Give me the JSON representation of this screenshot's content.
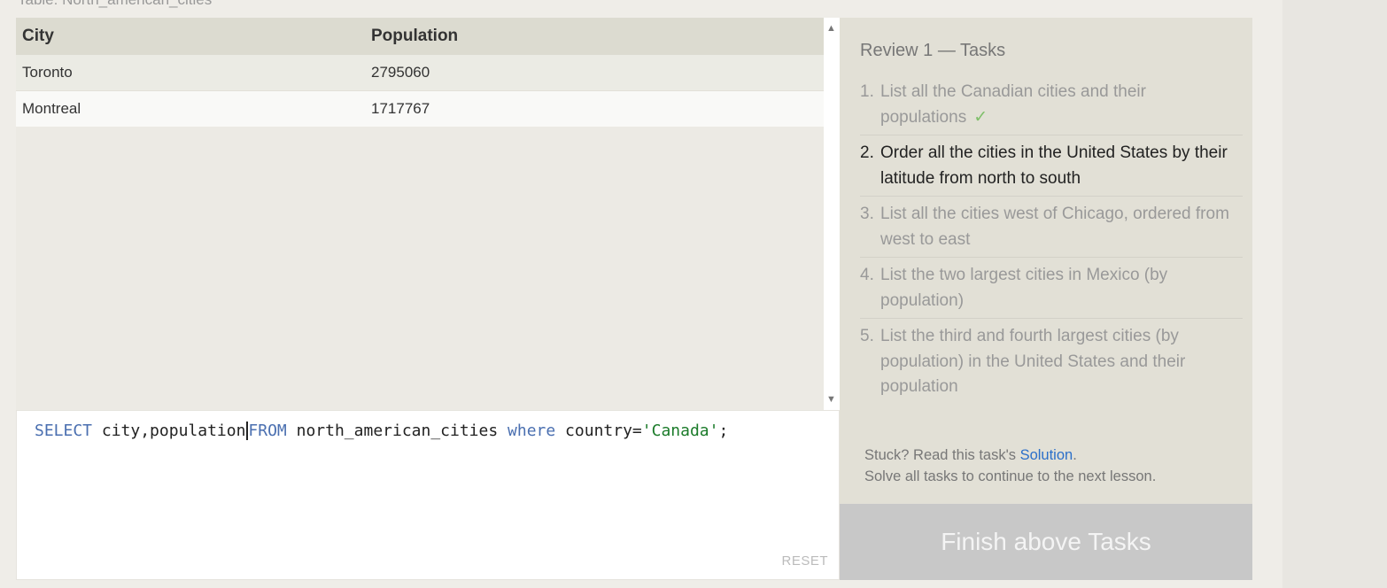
{
  "table_caption": "Table: North_american_cities",
  "results": {
    "columns": [
      "City",
      "Population"
    ],
    "rows": [
      [
        "Toronto",
        "2795060"
      ],
      [
        "Montreal",
        "1717767"
      ]
    ]
  },
  "editor": {
    "tokens": {
      "select": "SELECT",
      "cols": " city,population",
      "from": "FROM",
      "table": " north_american_cities ",
      "where": "where",
      "cond": " country=",
      "str": "'Canada'",
      "end": ";"
    },
    "reset_label": "RESET"
  },
  "tasks": {
    "title": "Review 1 — Tasks",
    "items": [
      {
        "num": "1.",
        "text": "List all the Canadian cities and their populations",
        "done": true,
        "check": "✓"
      },
      {
        "num": "2.",
        "text": "Order all the cities in the United States by their latitude from north to south",
        "active": true
      },
      {
        "num": "3.",
        "text": "List all the cities west of Chicago, ordered from west to east"
      },
      {
        "num": "4.",
        "text": "List the two largest cities in Mexico (by population)"
      },
      {
        "num": "5.",
        "text": "List the third and fourth largest cities (by population) in the United States and their population"
      }
    ],
    "stuck_prefix": "Stuck? Read this task's ",
    "solution_link": "Solution",
    "stuck_suffix": ".",
    "stuck_line2": "Solve all tasks to continue to the next lesson."
  },
  "finish_button": "Finish above Tasks",
  "colors": {
    "keyword": "#4a6fb0",
    "string": "#1b7b2a",
    "link": "#2b6fc9",
    "check": "#7fbf6a"
  },
  "icons": [
    "scroll-up-icon",
    "scroll-down-icon",
    "check-icon"
  ]
}
